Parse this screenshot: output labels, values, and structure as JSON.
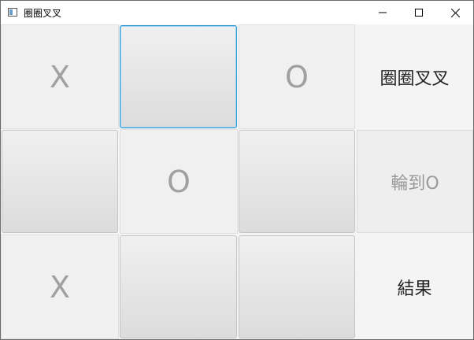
{
  "window": {
    "title": "圈圈叉叉"
  },
  "controls": {
    "minimize_icon": "minimize-icon",
    "maximize_icon": "maximize-icon",
    "close_icon": "close-icon"
  },
  "board": {
    "cells": [
      "X",
      "",
      "O",
      "",
      "O",
      "",
      "X",
      "",
      ""
    ]
  },
  "side": {
    "title": "圈圈叉叉",
    "turn": "輪到O",
    "result": "結果"
  },
  "colors": {
    "focus_border": "#2c9ad6",
    "mark": "#a0a0a0"
  }
}
